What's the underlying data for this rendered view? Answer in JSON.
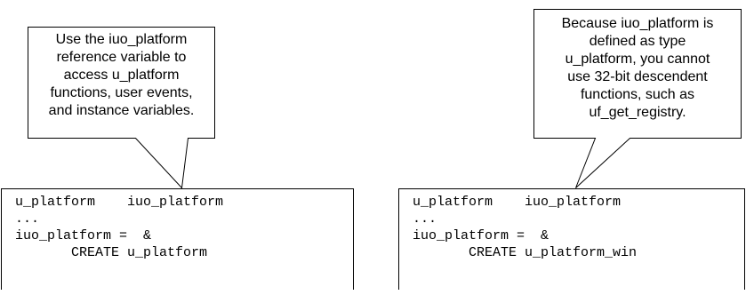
{
  "callouts": {
    "left": "Use the iuo_platform\nreference variable to\naccess u_platform\nfunctions, user events,\nand instance variables.",
    "right": "Because iuo_platform is\ndefined as type\nu_platform, you cannot\nuse 32-bit descendent\nfunctions, such as\nuf_get_registry."
  },
  "code": {
    "left": "u_platform    iuo_platform\n...\niuo_platform =  &\n       CREATE u_platform",
    "right": "u_platform    iuo_platform\n...\niuo_platform =  &\n       CREATE u_platform_win"
  }
}
